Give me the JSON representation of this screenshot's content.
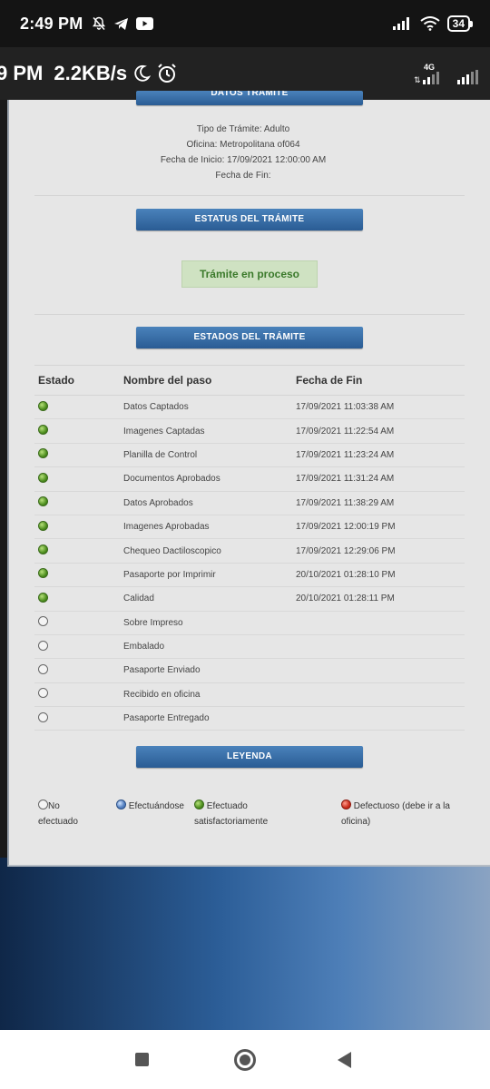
{
  "status_bar": {
    "time": "2:49 PM",
    "battery": "34"
  },
  "overlay_bar": {
    "time_fragment": "9 PM",
    "speed": "2.2KB/s",
    "network": "4G"
  },
  "tramite_info": {
    "header_cut": "DATOS TRÁMITE",
    "tipo": "Tipo de Trámite: Adulto",
    "oficina": "Oficina: Metropolitana of064",
    "fecha_inicio": "Fecha de Inicio: 17/09/2021 12:00:00 AM",
    "fecha_fin": "Fecha de Fin:"
  },
  "estatus": {
    "header": "ESTATUS DEL TRÁMITE",
    "value": "Trámite en proceso"
  },
  "estados": {
    "header": "ESTADOS DEL TRÁMITE",
    "columns": [
      "Estado",
      "Nombre del paso",
      "Fecha de Fin"
    ],
    "rows": [
      {
        "state": "done",
        "name": "Datos Captados",
        "date": "17/09/2021 11:03:38 AM"
      },
      {
        "state": "done",
        "name": "Imagenes Captadas",
        "date": "17/09/2021 11:22:54 AM"
      },
      {
        "state": "done",
        "name": "Planilla de Control",
        "date": "17/09/2021 11:23:24 AM"
      },
      {
        "state": "done",
        "name": "Documentos Aprobados",
        "date": "17/09/2021 11:31:24 AM"
      },
      {
        "state": "done",
        "name": "Datos Aprobados",
        "date": "17/09/2021 11:38:29 AM"
      },
      {
        "state": "done",
        "name": "Imagenes Aprobadas",
        "date": "17/09/2021 12:00:19 PM"
      },
      {
        "state": "done",
        "name": "Chequeo Dactiloscopico",
        "date": "17/09/2021 12:29:06 PM"
      },
      {
        "state": "done",
        "name": "Pasaporte por Imprimir",
        "date": "20/10/2021 01:28:10 PM"
      },
      {
        "state": "done",
        "name": "Calidad",
        "date": "20/10/2021 01:28:11 PM"
      },
      {
        "state": "pending",
        "name": "Sobre Impreso",
        "date": ""
      },
      {
        "state": "pending",
        "name": "Embalado",
        "date": ""
      },
      {
        "state": "pending",
        "name": "Pasaporte Enviado",
        "date": ""
      },
      {
        "state": "pending",
        "name": "Recibido en oficina",
        "date": ""
      },
      {
        "state": "pending",
        "name": "Pasaporte Entregado",
        "date": ""
      }
    ]
  },
  "leyenda": {
    "header": "LEYENDA",
    "no_efectuado_1": "No",
    "no_efectuado_2": "efectuado",
    "efectuandose": "Efectuándose",
    "efectuado_1": "Efectuado",
    "efectuado_2": "satisfactoriamente",
    "defectuoso_1": "Defectuoso (debe ir a la",
    "defectuoso_2": "oficina)"
  },
  "colors": {
    "header_blue": "#2a5c94",
    "status_green": "#3b7a2b",
    "status_bg": "#cfe2c2"
  }
}
